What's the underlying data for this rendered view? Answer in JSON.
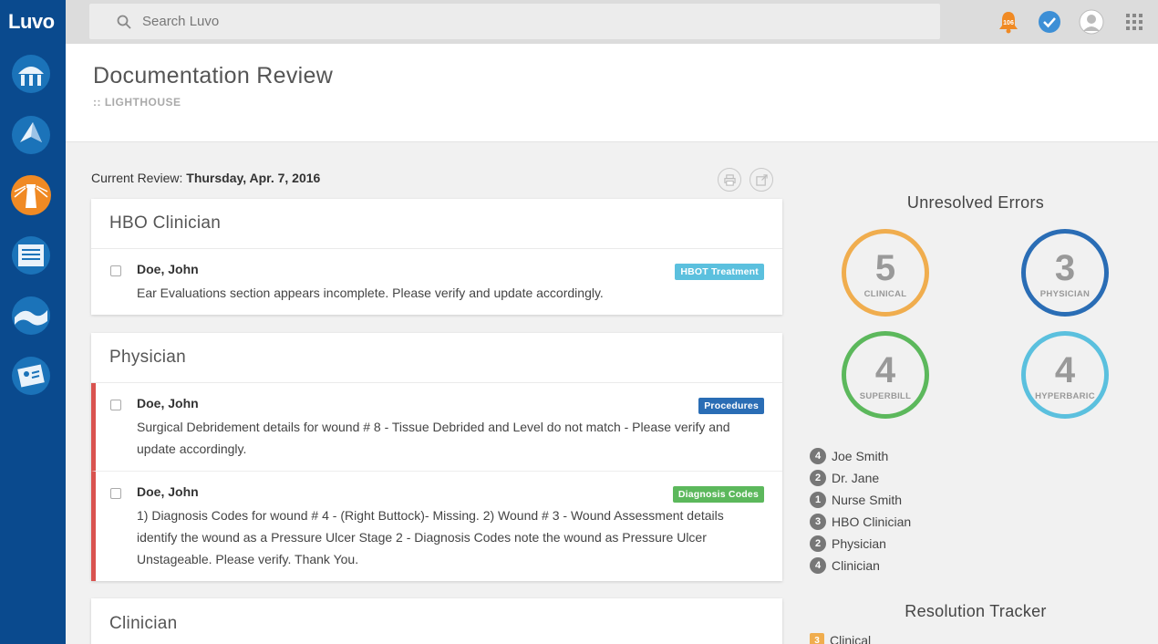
{
  "app": {
    "logo": "Luvo"
  },
  "search": {
    "placeholder": "Search Luvo"
  },
  "topbar": {
    "notifications_count": "106",
    "icons": [
      "bell-icon",
      "check-icon",
      "avatar",
      "apps-grid-icon"
    ]
  },
  "sidebar": {
    "items": [
      {
        "icon": "dome-icon"
      },
      {
        "icon": "navigation-icon"
      },
      {
        "icon": "lighthouse-icon"
      },
      {
        "icon": "document-list-icon"
      },
      {
        "icon": "wave-icon"
      },
      {
        "icon": "patient-card-icon"
      }
    ]
  },
  "header": {
    "title": "Documentation Review",
    "subtitle": ":: LIGHTHOUSE"
  },
  "review": {
    "label": "Current Review:",
    "date": "Thursday, Apr. 7, 2016"
  },
  "sections": [
    {
      "title": "HBO Clinician",
      "items": [
        {
          "name": "Doe, John",
          "message": "Ear Evaluations section appears incomplete. Please verify and update accordingly.",
          "tag": "HBOT Treatment",
          "tag_color": "#5bc0de"
        }
      ]
    },
    {
      "title": "Physician",
      "items": [
        {
          "name": "Doe, John",
          "message": "Surgical Debridement details for wound # 8 - Tissue Debrided and Level do not match - Please verify and update accordingly.",
          "tag": "Procedures",
          "tag_color": "#2a6db5"
        },
        {
          "name": "Doe, John",
          "message": "1) Diagnosis Codes for wound # 4 - (Right Buttock)- Missing. 2) Wound # 3 - Wound Assessment details identify the wound as a Pressure Ulcer Stage 2 - Diagnosis Codes note the wound as Pressure Ulcer Unstageable. Please verify. Thank You.",
          "tag": "Diagnosis Codes",
          "tag_color": "#5cb85c"
        }
      ]
    },
    {
      "title": "Clinician",
      "items": []
    }
  ],
  "unresolved": {
    "title": "Unresolved Errors",
    "rings": [
      {
        "value": "5",
        "label": "CLINICAL",
        "color": "#f0ad4e"
      },
      {
        "value": "3",
        "label": "PHYSICIAN",
        "color": "#2a6db5"
      },
      {
        "value": "4",
        "label": "SUPERBILL",
        "color": "#5cb85c"
      },
      {
        "value": "4",
        "label": "HYPERBARIC",
        "color": "#5bc0de"
      }
    ],
    "people": [
      {
        "count": "4",
        "name": "Joe Smith"
      },
      {
        "count": "2",
        "name": "Dr. Jane"
      },
      {
        "count": "1",
        "name": "Nurse Smith"
      },
      {
        "count": "3",
        "name": "HBO Clinician"
      },
      {
        "count": "2",
        "name": "Physician"
      },
      {
        "count": "4",
        "name": "Clinician"
      }
    ]
  },
  "tracker": {
    "title": "Resolution Tracker",
    "items": [
      {
        "count": "3",
        "name": "Clinical"
      }
    ]
  }
}
